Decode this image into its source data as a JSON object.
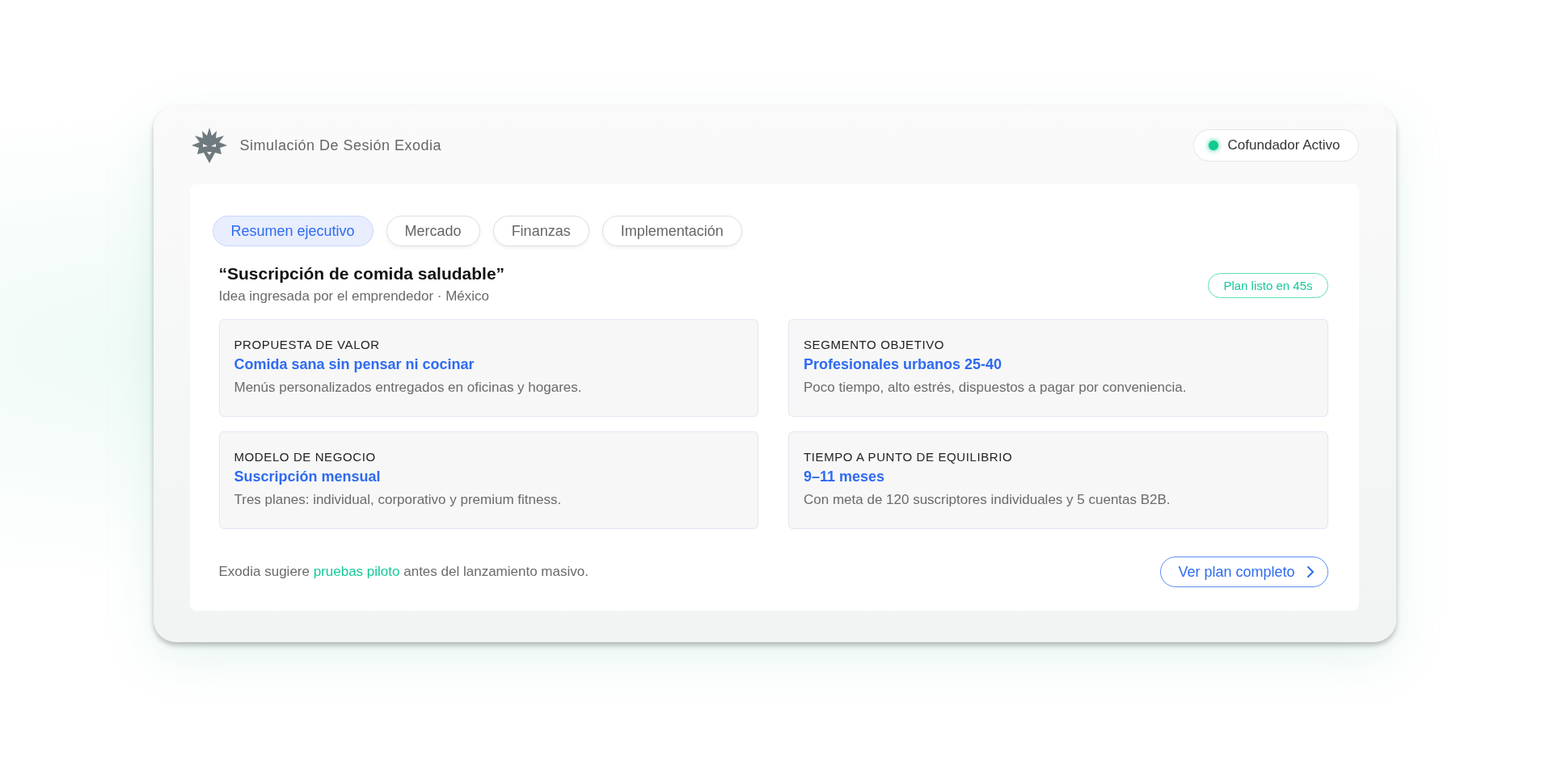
{
  "header": {
    "title": "Simulación De Sesión Exodia",
    "status": {
      "label": "Cofundador Activo",
      "color": "#10c98f"
    }
  },
  "tabs": [
    {
      "label": "Resumen ejecutivo",
      "selected": true
    },
    {
      "label": "Mercado",
      "selected": false
    },
    {
      "label": "Finanzas",
      "selected": false
    },
    {
      "label": "Implementación",
      "selected": false
    }
  ],
  "idea": {
    "title": "“Suscripción de comida saludable”",
    "subtitle": "Idea ingresada por el emprendedor · México",
    "badge": "Plan listo en 45s"
  },
  "cards": [
    {
      "label": "PROPUESTA DE VALOR",
      "headline": "Comida sana sin pensar ni cocinar",
      "detail": "Menús personalizados entregados en oficinas y hogares."
    },
    {
      "label": "SEGMENTO OBJETIVO",
      "headline": "Profesionales urbanos 25-40",
      "detail": "Poco tiempo, alto estrés, dispuestos a pagar por conveniencia."
    },
    {
      "label": "MODELO DE NEGOCIO",
      "headline": "Suscripción mensual",
      "detail": "Tres planes: individual, corporativo y premium fitness."
    },
    {
      "label": "TIEMPO A PUNTO DE EQUILIBRIO",
      "headline": "9–11 meses",
      "detail": "Con meta de 120 suscriptores individuales y 5 cuentas B2B."
    }
  ],
  "footer": {
    "note": "Exodia sugiere **pruebas piloto** antes del lanzamiento masivo.",
    "button": "Ver plan completo"
  }
}
